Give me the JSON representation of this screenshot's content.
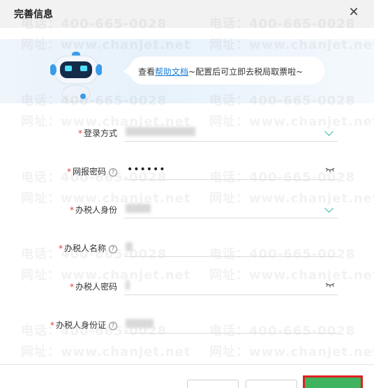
{
  "dialog": {
    "title": "完善信息"
  },
  "banner": {
    "text_before": "查看",
    "link_text": "帮助文档",
    "text_after": "~配置后可立即去税局取票啦~"
  },
  "watermark": {
    "phone": "电话：400-665-0028",
    "site": "网址：www.chanjet.net"
  },
  "fields": [
    {
      "label": "登录方式",
      "required": true,
      "help": false,
      "type": "select"
    },
    {
      "label": "网报密码",
      "required": true,
      "help": true,
      "type": "password",
      "value": "••••••"
    },
    {
      "label": "办税人身份",
      "required": true,
      "help": false,
      "type": "select"
    },
    {
      "label": "办税人名称",
      "required": true,
      "help": true,
      "type": "text"
    },
    {
      "label": "办税人密码",
      "required": true,
      "help": false,
      "type": "password"
    },
    {
      "label": "办税人身份证",
      "required": true,
      "help": true,
      "type": "text"
    }
  ],
  "colors": {
    "accent": "#39b6a8",
    "required": "#e23a3a",
    "link": "#1e7fd6",
    "primary": "#3fb35d",
    "highlight": "#e02020"
  },
  "icons": {
    "close": "close-icon",
    "help": "question-circle-icon",
    "select": "chevron-down-icon",
    "password": "eye-closed-icon"
  }
}
